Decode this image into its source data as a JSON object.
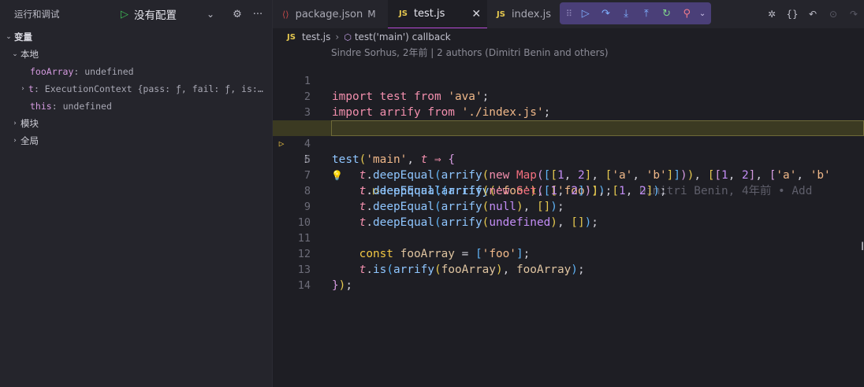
{
  "sidebar": {
    "title": "运行和调试",
    "config_name": "没有配置",
    "sections": {
      "variables": "变量",
      "local": "本地",
      "module": "模块",
      "global": "全局"
    },
    "vars": [
      {
        "name": "fooArray",
        "value": "undefined"
      },
      {
        "name": "t",
        "value": "ExecutionContext {pass: ƒ, fail: ƒ, is:…"
      },
      {
        "name": "this",
        "value": "undefined"
      }
    ]
  },
  "tabs": [
    {
      "label": "package.json",
      "badge": "M"
    },
    {
      "label": "test.js"
    },
    {
      "label": "index.js"
    }
  ],
  "file_badge": "JS",
  "breadcrumb": {
    "file": "test.js",
    "symbol": "test('main') callback"
  },
  "codelens": "Sindre Sorhus, 2年前 | 2 authors (Dimitri Benin and others)",
  "blame": "Dimitri Benin, 4年前 • Add",
  "line_numbers": [
    "1",
    "2",
    "3",
    "4",
    "5",
    "6",
    "7",
    "8",
    "9",
    "10",
    "11",
    "12",
    "13",
    "14"
  ],
  "current_line": 5,
  "colors": {
    "accent_tab": "#b64ad6",
    "debug_toolbar": "#4a3f78",
    "breakpoint": "#e51400",
    "current_line_bg": "#3b3a22"
  },
  "icons": {
    "run": "play-icon",
    "settings": "gear-icon",
    "more": "ellipsis-icon",
    "continue": "continue-icon",
    "step_over": "step-over-icon",
    "step_into": "step-into-icon",
    "step_out": "step-out-icon",
    "restart": "restart-icon",
    "disconnect": "disconnect-icon"
  }
}
